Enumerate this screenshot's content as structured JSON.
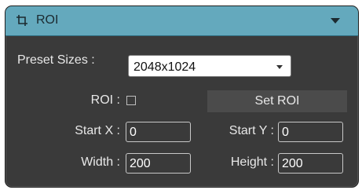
{
  "panel": {
    "title": "ROI",
    "header_icon": "crop-icon",
    "collapse_icon": "caret-down-icon",
    "colors": {
      "header": "#64a9bd",
      "body": "#3a3a3a"
    }
  },
  "preset": {
    "label": "Preset Sizes :",
    "value": "2048x1024"
  },
  "roi": {
    "label": "ROI :",
    "checked": false,
    "button_label": "Set ROI"
  },
  "fields": {
    "start_x": {
      "label": "Start X :",
      "value": "0"
    },
    "start_y": {
      "label": "Start Y :",
      "value": "0"
    },
    "width": {
      "label": "Width :",
      "value": "200"
    },
    "height": {
      "label": "Height :",
      "value": "200"
    }
  }
}
